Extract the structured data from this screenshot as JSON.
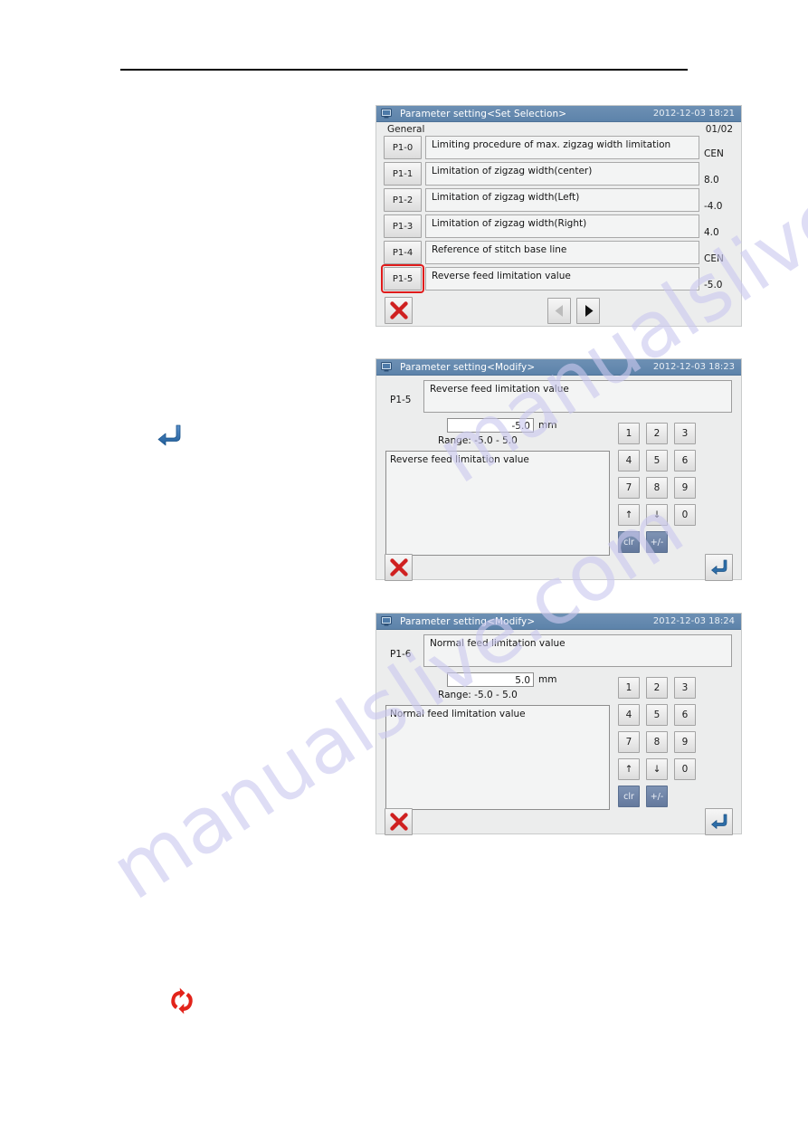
{
  "document": {
    "rule_present": true
  },
  "watermark": {
    "line1": "manualslive.com",
    "line2": "manualslive.com"
  },
  "standalone_icons": [
    {
      "name": "enter-return-icon",
      "glyph": "↵",
      "color": "#2f6fb0"
    },
    {
      "name": "reset-refresh-icon",
      "glyph": "⟳",
      "color": "#e2231a"
    }
  ],
  "panels": [
    {
      "id": "set-selection",
      "titlebar": {
        "icon": "monitor-icon",
        "title": "Parameter setting<Set Selection>",
        "datetime": "2012-12-03  18:21"
      },
      "list": {
        "group_label": "General",
        "page_indicator": "01/02",
        "rows": [
          {
            "key": "P1-0",
            "description": "Limiting procedure of max. zigzag width limitation",
            "value": "CEN",
            "selected": false
          },
          {
            "key": "P1-1",
            "description": "Limitation of zigzag width(center)",
            "value": "8.0",
            "selected": false
          },
          {
            "key": "P1-2",
            "description": "Limitation of zigzag width(Left)",
            "value": "-4.0",
            "selected": false
          },
          {
            "key": "P1-3",
            "description": "Limitation of zigzag width(Right)",
            "value": "4.0",
            "selected": false
          },
          {
            "key": "P1-4",
            "description": "Reference of stitch base line",
            "value": "CEN",
            "selected": false
          },
          {
            "key": "P1-5",
            "description": "Reverse feed limitation value",
            "value": "-5.0",
            "selected": true
          }
        ],
        "footer": {
          "close_icon": "close-x-icon",
          "prev_icon": "triangle-left-icon",
          "prev_enabled": false,
          "next_icon": "triangle-right-icon",
          "next_enabled": true
        }
      }
    },
    {
      "id": "modify-p1-5",
      "titlebar": {
        "icon": "monitor-icon",
        "title": "Parameter setting<Modify>",
        "datetime": "2012-12-03  18:23"
      },
      "modify": {
        "param_key": "P1-5",
        "param_title": "Reverse feed limitation value",
        "value": "-5.0",
        "unit": "mm",
        "range_label": "Range: -5.0  -  5.0",
        "description": "Reverse feed limitation value",
        "keypad": {
          "digits": [
            "1",
            "2",
            "3",
            "4",
            "5",
            "6",
            "7",
            "8",
            "9"
          ],
          "row4": [
            "↑",
            "↓",
            "0"
          ],
          "functions": [
            "clr",
            "+/-"
          ]
        },
        "footer": {
          "close_icon": "close-x-icon",
          "enter_icon": "enter-return-icon"
        }
      }
    },
    {
      "id": "modify-p1-6",
      "titlebar": {
        "icon": "monitor-icon",
        "title": "Parameter setting<Modify>",
        "datetime": "2012-12-03  18:24"
      },
      "modify": {
        "param_key": "P1-6",
        "param_title": "Normal feed limitation value",
        "value": "5.0",
        "unit": "mm",
        "range_label": "Range: -5.0  -  5.0",
        "description": "Normal feed limitation value",
        "keypad": {
          "digits": [
            "1",
            "2",
            "3",
            "4",
            "5",
            "6",
            "7",
            "8",
            "9"
          ],
          "row4": [
            "↑",
            "↓",
            "0"
          ],
          "functions": [
            "clr",
            "+/-"
          ]
        },
        "footer": {
          "close_icon": "close-x-icon",
          "enter_icon": "enter-return-icon"
        }
      }
    }
  ],
  "colors": {
    "titlebar": "#5d83aa",
    "panel_bg": "#eceded",
    "selection_outline": "#e01b1b",
    "keypad_blue": "#64799d",
    "watermark": "#cbc9ef"
  }
}
